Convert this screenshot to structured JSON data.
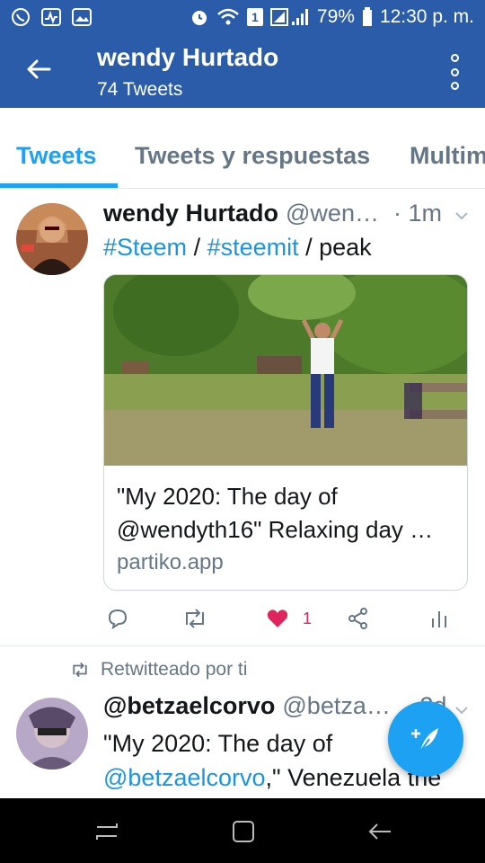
{
  "status_bar": {
    "battery": "79%",
    "time": "12:30 p. m.",
    "sim_badge": "1"
  },
  "app_bar": {
    "title": "wendy Hurtado",
    "subtitle": "74 Tweets"
  },
  "tabs": [
    {
      "label": "Tweets",
      "active": true
    },
    {
      "label": "Tweets y respuestas",
      "active": false
    },
    {
      "label": "Multim",
      "active": false
    }
  ],
  "tweet1": {
    "name": "wendy Hurtado",
    "handle": "@wen…",
    "time": "· 1m",
    "text_parts": {
      "tag1": "#Steem",
      "sep1": " / ",
      "tag2": "#steemit",
      "sep2": " / peak"
    },
    "card": {
      "title": "\"My 2020: The day of @wendyth16\" Relaxing day …",
      "domain": "partiko.app"
    },
    "like_count": "1"
  },
  "retweet_label": "Retwitteado por ti",
  "tweet2": {
    "name": "@betzaelcorvo",
    "handle": "@betza…",
    "time": "· 2d",
    "text_line1": "\"My 2020: The day of",
    "text_link": "@betzaelcorvo",
    "text_rest": ",\" Venezuela the"
  },
  "colors": {
    "header": "#2a5caa",
    "accent": "#1da1f2",
    "like": "#e0245e",
    "muted": "#657786"
  }
}
